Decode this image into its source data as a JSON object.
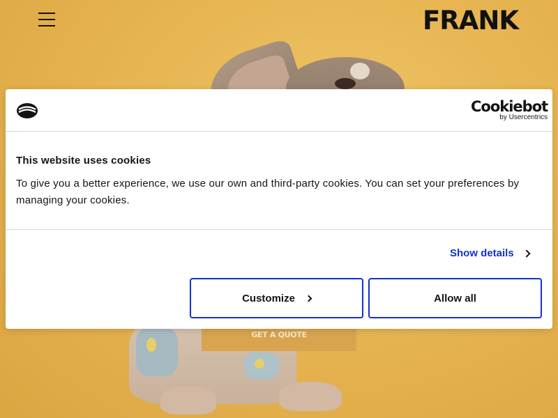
{
  "header": {
    "logo_text": "FRANK",
    "menu_icon": "hamburger-menu-icon"
  },
  "hero": {
    "cta_label": "GET A QUOTE"
  },
  "cookie_banner": {
    "brand_name": "Cookiebot",
    "brand_sub": "by Usercentrics",
    "title": "This website uses cookies",
    "text": "To give you a better experience, we use our own and third-party cookies. You can set your preferences by managing your cookies.",
    "show_details_label": "Show details",
    "customize_label": "Customize",
    "allow_all_label": "Allow all",
    "accent_color": "#1032cf"
  }
}
